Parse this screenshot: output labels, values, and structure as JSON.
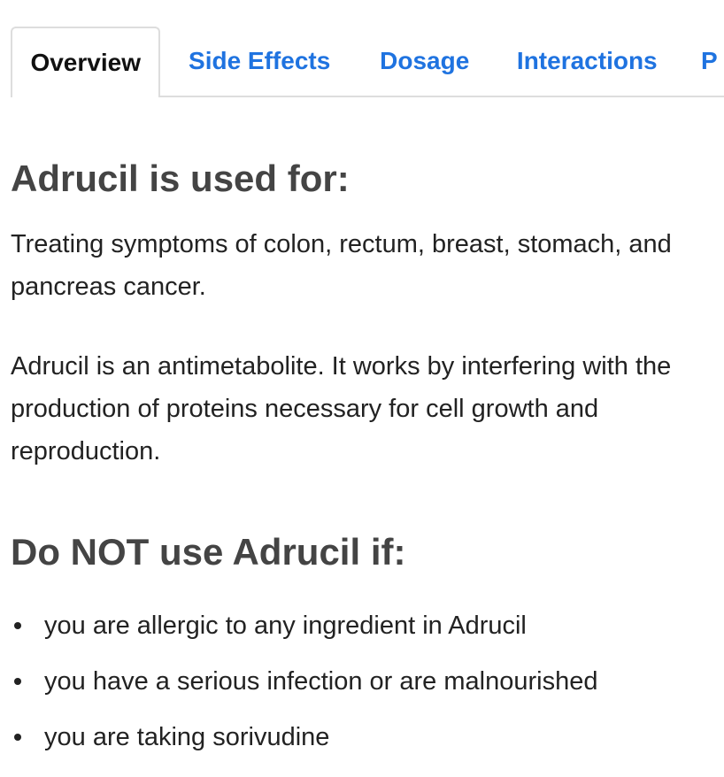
{
  "tabs": [
    {
      "label": "Overview",
      "active": true
    },
    {
      "label": "Side Effects",
      "active": false
    },
    {
      "label": "Dosage",
      "active": false
    },
    {
      "label": "Interactions",
      "active": false
    },
    {
      "label": "P",
      "active": false
    }
  ],
  "section_used": {
    "heading": "Adrucil is used for:",
    "paragraphs": [
      "Treating symptoms of colon, rectum, breast, stomach, and pancreas cancer.",
      "Adrucil is an antimetabolite. It works by interfering with the production of proteins necessary for cell growth and reproduction."
    ]
  },
  "section_donot": {
    "heading": "Do NOT use Adrucil if:",
    "items": [
      "you are allergic to any ingredient in Adrucil",
      "you have a serious infection or are malnourished",
      "you are taking sorivudine"
    ]
  },
  "colors": {
    "tab_link": "#1f73e0",
    "tab_active": "#111111",
    "heading": "#444444",
    "body_text": "#222222",
    "border": "#dddddd"
  }
}
